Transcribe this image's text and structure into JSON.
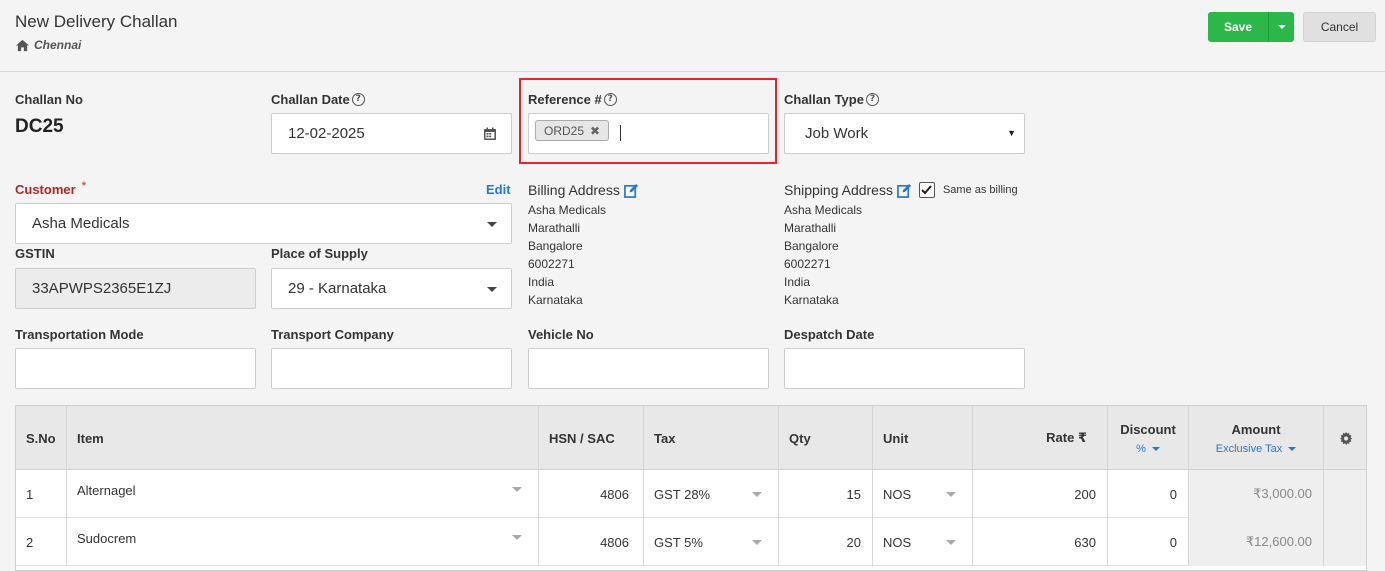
{
  "header": {
    "title": "New Delivery Challan",
    "branch": "Chennai",
    "save_label": "Save",
    "cancel_label": "Cancel"
  },
  "form": {
    "challan_no_label": "Challan No",
    "challan_no": "DC25",
    "challan_date_label": "Challan Date",
    "challan_date": "12-02-2025",
    "reference_label": "Reference #",
    "reference_tag": "ORD25",
    "challan_type_label": "Challan Type",
    "challan_type": "Job Work",
    "customer_label": "Customer",
    "customer_required": "*",
    "edit_label": "Edit",
    "customer": "Asha Medicals",
    "gstin_label": "GSTIN",
    "gstin": "33APWPS2365E1ZJ",
    "place_label": "Place of Supply",
    "place": "29 - Karnataka",
    "transport_mode_label": "Transportation Mode",
    "transport_company_label": "Transport Company",
    "vehicle_label": "Vehicle No",
    "despatch_label": "Despatch Date"
  },
  "billing": {
    "title": "Billing Address",
    "lines": [
      "Asha Medicals",
      "Marathalli",
      "Bangalore",
      "6002271",
      "India",
      "Karnataka"
    ]
  },
  "shipping": {
    "title": "Shipping Address",
    "same_label": "Same as billing",
    "same_checked": true,
    "lines": [
      "Asha Medicals",
      "Marathalli",
      "Bangalore",
      "6002271",
      "India",
      "Karnataka"
    ]
  },
  "table": {
    "headers": {
      "sno": "S.No",
      "item": "Item",
      "hsn": "HSN / SAC",
      "tax": "Tax",
      "qty": "Qty",
      "unit": "Unit",
      "rate": "Rate ₹",
      "discount": "Discount",
      "discount_sub": "%",
      "amount": "Amount",
      "amount_sub": "Exclusive Tax"
    },
    "rows": [
      {
        "sno": "1",
        "item": "Alternagel",
        "hsn": "4806",
        "tax": "GST 28%",
        "qty": "15",
        "unit": "NOS",
        "rate": "200",
        "discount": "0",
        "amount": "₹3,000.00"
      },
      {
        "sno": "2",
        "item": "Sudocrem",
        "hsn": "4806",
        "tax": "GST 5%",
        "qty": "20",
        "unit": "NOS",
        "rate": "630",
        "discount": "0",
        "amount": "₹12,600.00"
      }
    ]
  },
  "colors": {
    "save_green": "#2bb74a",
    "link_blue": "#2a78c2",
    "highlight_red": "#e3262b",
    "required_red": "#a42b2b"
  }
}
